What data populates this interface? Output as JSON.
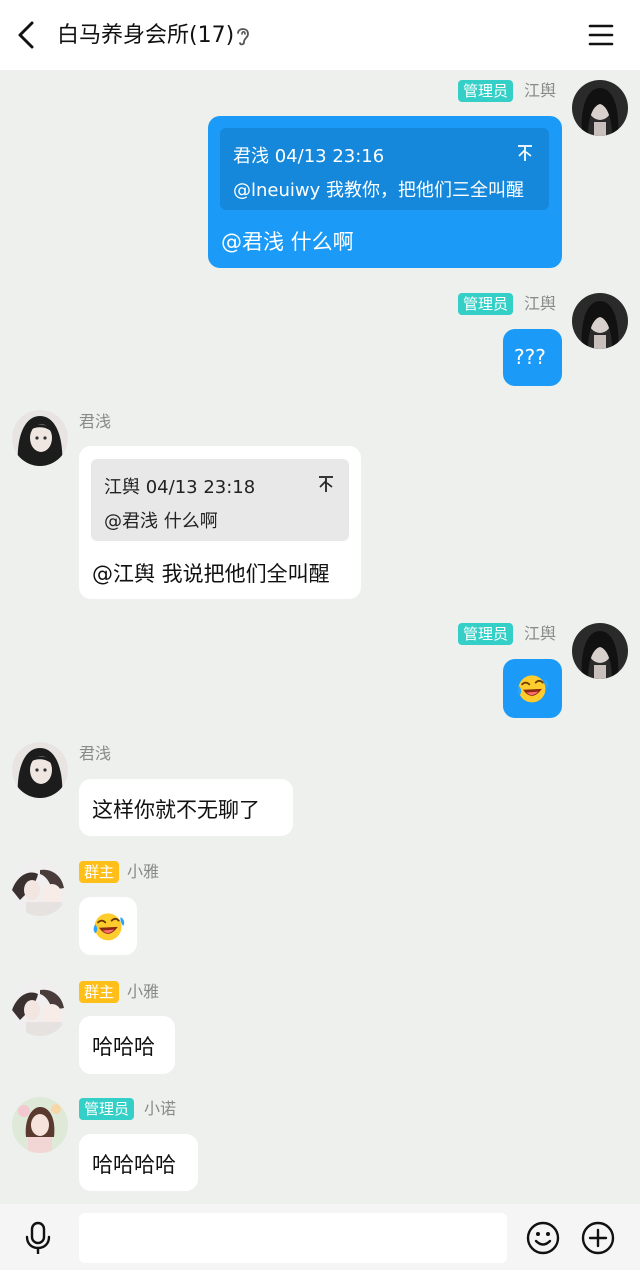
{
  "header": {
    "title": "白马养身会所(17)",
    "icons": {
      "back": "chevron-left-icon",
      "ear": "ear-icon",
      "menu": "hamburger-menu-icon"
    }
  },
  "messages": [
    {
      "side": "right",
      "badge": "管理员",
      "badge_type": "admin",
      "sender": "江舆",
      "quote_meta": "君浅 04/13 23:16",
      "quote_text": "@lneuiwy 我教你，把他们三全叫醒",
      "text": "@君浅 什么啊"
    },
    {
      "side": "right",
      "badge": "管理员",
      "badge_type": "admin",
      "sender": "江舆",
      "text": "???"
    },
    {
      "side": "left",
      "sender": "君浅",
      "quote_meta": "江舆 04/13 23:18",
      "quote_text": "@君浅 什么啊",
      "text": "@江舆 我说把他们全叫醒"
    },
    {
      "side": "right",
      "badge": "管理员",
      "badge_type": "admin",
      "sender": "江舆",
      "emoji": "laughing-tears-emoji"
    },
    {
      "side": "left",
      "sender": "君浅",
      "text": "这样你就不无聊了"
    },
    {
      "side": "left",
      "badge": "群主",
      "badge_type": "owner",
      "sender": "小雅",
      "emoji": "laughing-tears-emoji"
    },
    {
      "side": "left",
      "badge": "群主",
      "badge_type": "owner",
      "sender": "小雅",
      "text": "哈哈哈"
    },
    {
      "side": "left",
      "badge": "管理员",
      "badge_type": "admin",
      "sender": "小诺",
      "text": "哈哈哈哈"
    }
  ],
  "input_bar": {
    "placeholder": "",
    "icons": {
      "mic": "microphone-icon",
      "emoji": "smiley-icon",
      "plus": "plus-circle-icon"
    }
  },
  "colors": {
    "background": "#edf0ed",
    "blue_bubble": "#1b9bf7",
    "admin_badge": "#34cfc6",
    "owner_badge": "#ffbf18"
  }
}
